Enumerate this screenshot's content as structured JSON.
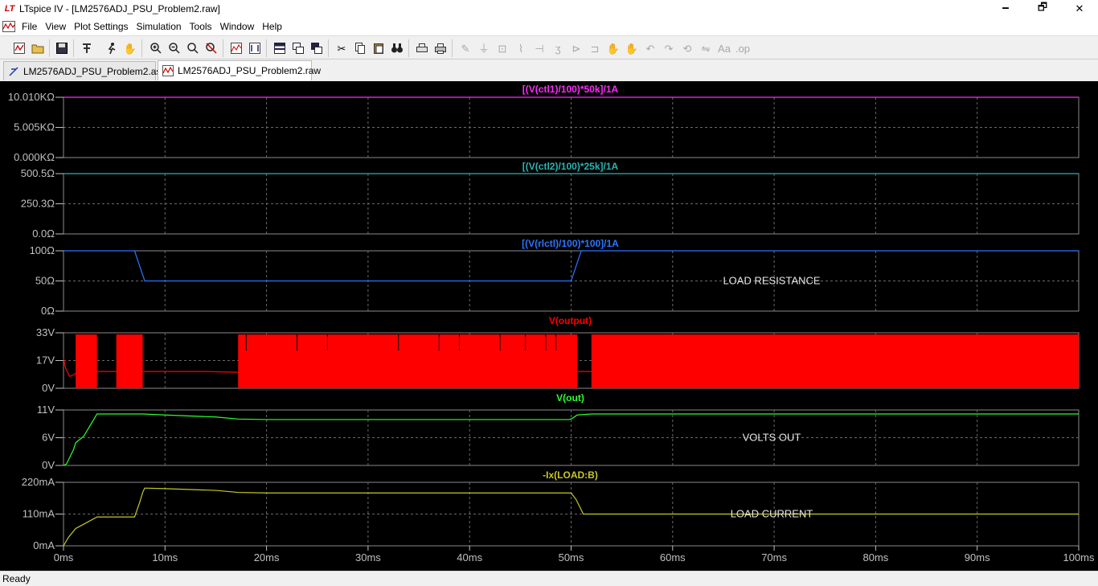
{
  "window": {
    "title": "LTspice IV - [LM2576ADJ_PSU_Problem2.raw]",
    "app_icon_text": "LT",
    "minimize": "🗕",
    "maximize": "🗗",
    "close": "✕"
  },
  "menu": [
    "File",
    "View",
    "Plot Settings",
    "Simulation",
    "Tools",
    "Window",
    "Help"
  ],
  "mdi_controls": [
    "–",
    "⧉",
    "×"
  ],
  "tabs": [
    {
      "label": "LM2576ADJ_PSU_Problem2.asc",
      "icon": "schematic-icon",
      "active": false
    },
    {
      "label": "LM2576ADJ_PSU_Problem2.raw",
      "icon": "waveform-icon",
      "active": true
    }
  ],
  "status": "Ready",
  "colors": {
    "grid": "#6a6a6a",
    "frame": "#8a8a8a",
    "label": "#c0c0c0",
    "magenta": "#ff2bff",
    "teal": "#28b4b4",
    "blue": "#2a75ff",
    "red": "#ff0000",
    "green": "#2bff2b",
    "yellow": "#c8c828"
  },
  "x_axis": {
    "unit": "ms",
    "ticks": [
      "0ms",
      "10ms",
      "20ms",
      "30ms",
      "40ms",
      "50ms",
      "60ms",
      "70ms",
      "80ms",
      "90ms",
      "100ms"
    ]
  },
  "panes": [
    {
      "id": "ctl1",
      "title": "[(V(ctl1)/100)*50k]/1A",
      "color": "magenta",
      "yticks": [
        "10.010KΩ",
        "5.005KΩ",
        "0.000KΩ"
      ],
      "annotation": ""
    },
    {
      "id": "ctl2",
      "title": "[(V(ctl2)/100)*25k]/1A",
      "color": "teal",
      "yticks": [
        "500.5Ω",
        "250.3Ω",
        "0.0Ω"
      ],
      "annotation": ""
    },
    {
      "id": "rlctl",
      "title": "[(V(rlctl)/100)*100]/1A",
      "color": "blue",
      "yticks": [
        "100Ω",
        "50Ω",
        "0Ω"
      ],
      "annotation": "LOAD RESISTANCE"
    },
    {
      "id": "output",
      "title": "V(output)",
      "color": "red",
      "yticks": [
        "33V",
        "17V",
        "0V"
      ],
      "annotation": ""
    },
    {
      "id": "out",
      "title": "V(out)",
      "color": "green",
      "yticks": [
        "11V",
        "6V",
        "0V"
      ],
      "annotation": "VOLTS OUT"
    },
    {
      "id": "load",
      "title": "-Ix(LOAD:B)",
      "color": "yellow",
      "yticks": [
        "220mA",
        "110mA",
        "0mA"
      ],
      "annotation": "LOAD CURRENT"
    }
  ],
  "chart_data": [
    {
      "type": "line",
      "title": "[(V(ctl1)/100)*50k]/1A",
      "xlabel": "",
      "ylabel": "",
      "xlim": [
        0,
        100
      ],
      "ylim": [
        0,
        10010
      ],
      "series": [
        {
          "x": [
            0,
            100
          ],
          "y": [
            10010,
            10010
          ]
        }
      ]
    },
    {
      "type": "line",
      "title": "[(V(ctl2)/100)*25k]/1A",
      "xlabel": "",
      "ylabel": "",
      "xlim": [
        0,
        100
      ],
      "ylim": [
        0,
        500.5
      ],
      "series": [
        {
          "x": [
            0,
            100
          ],
          "y": [
            500.5,
            500.5
          ]
        }
      ]
    },
    {
      "type": "line",
      "title": "[(V(rlctl)/100)*100]/1A",
      "xlabel": "",
      "ylabel": "",
      "xlim": [
        0,
        100
      ],
      "ylim": [
        0,
        100
      ],
      "series": [
        {
          "x": [
            0,
            7,
            8,
            50,
            51,
            100
          ],
          "y": [
            100,
            100,
            50,
            50,
            100,
            100
          ]
        }
      ]
    },
    {
      "type": "area",
      "title": "V(output)",
      "xlabel": "",
      "ylabel": "",
      "xlim": [
        0,
        100
      ],
      "ylim": [
        0,
        33
      ],
      "switching_regions_ms": [
        [
          1.2,
          3.3
        ],
        [
          5.2,
          7.8
        ],
        [
          17.2,
          50.6
        ],
        [
          52.0,
          100
        ]
      ],
      "switching_high_V": 32,
      "switching_low_V": 0,
      "idle_x": [
        0,
        0.2,
        0.6,
        1.0,
        1.2,
        3.3,
        5.2,
        7.8,
        14,
        17.2,
        50.6,
        52.0
      ],
      "idle_y": [
        18,
        12,
        7,
        8,
        9,
        10,
        10,
        10,
        10,
        9.5,
        10,
        10
      ]
    },
    {
      "type": "line",
      "title": "V(out)",
      "xlabel": "",
      "ylabel": "",
      "xlim": [
        0,
        100
      ],
      "ylim": [
        0,
        11
      ],
      "series": [
        {
          "x": [
            0,
            0.3,
            1.0,
            1.2,
            2.0,
            3.3,
            7.8,
            10,
            15,
            17.2,
            20,
            49.8,
            50.1,
            50.6,
            52.0,
            100
          ],
          "y": [
            0,
            0.3,
            3.2,
            4.5,
            5.8,
            10.2,
            10.2,
            10.0,
            9.6,
            9.2,
            9.1,
            9.1,
            9.3,
            10.0,
            10.2,
            10.2
          ]
        }
      ]
    },
    {
      "type": "line",
      "title": "-Ix(LOAD:B)",
      "xlabel": "",
      "ylabel": "",
      "xlim": [
        0,
        100
      ],
      "ylim": [
        0,
        220
      ],
      "series": [
        {
          "x": [
            0,
            0.5,
            1.2,
            2.0,
            3.3,
            7.0,
            7.5,
            7.8,
            8.0,
            10,
            15,
            17.2,
            20,
            50.0,
            50.5,
            51.2,
            100
          ],
          "y": [
            0,
            30,
            60,
            75,
            100,
            100,
            150,
            185,
            200,
            198,
            192,
            185,
            183,
            183,
            160,
            110,
            110
          ]
        }
      ]
    }
  ]
}
